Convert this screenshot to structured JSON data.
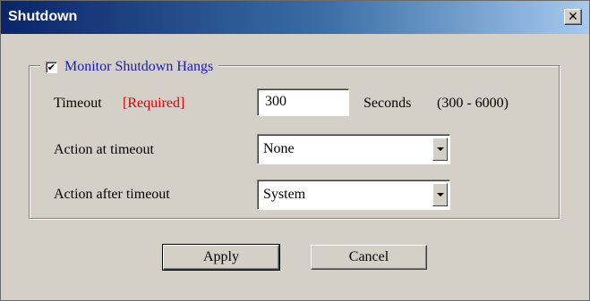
{
  "window": {
    "title": "Shutdown",
    "close_glyph": "✕"
  },
  "group": {
    "checkbox_checked": true,
    "check_glyph": "✔",
    "label": "Monitor Shutdown Hangs"
  },
  "timeout": {
    "label": "Timeout",
    "required": "[Required]",
    "value": "300",
    "unit": "Seconds",
    "range": "(300 - 6000)"
  },
  "action_at_timeout": {
    "label": "Action at timeout",
    "value": "None"
  },
  "action_after_timeout": {
    "label": "Action after timeout",
    "value": "System"
  },
  "buttons": {
    "apply": "Apply",
    "cancel": "Cancel"
  },
  "icons": {
    "close": "close-icon",
    "dropdown": "chevron-down-icon",
    "check": "check-icon"
  }
}
